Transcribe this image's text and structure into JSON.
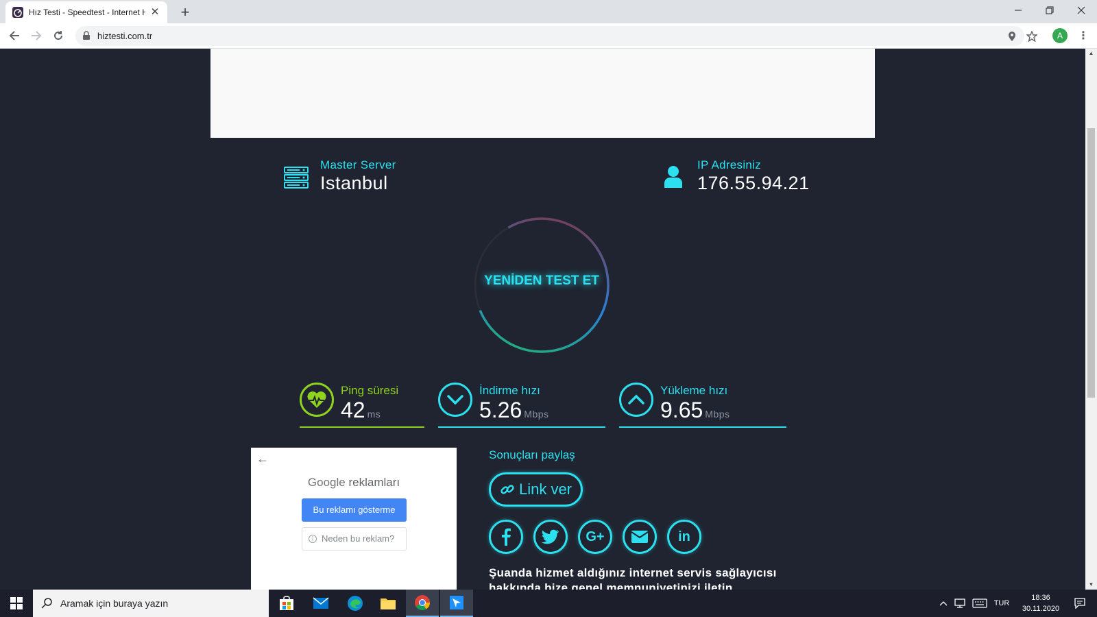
{
  "browser": {
    "tab_title": "Hız Testi - Speedtest - Internet Hız Testi",
    "url": "hiztesti.com.tr",
    "profile_initial": "A"
  },
  "server": {
    "label": "Master Server",
    "value": "Istanbul"
  },
  "ip": {
    "label": "IP Adresiniz",
    "value": "176.55.94.21"
  },
  "retest_label": "YENİDEN TEST ET",
  "metrics": {
    "ping": {
      "label": "Ping süresi",
      "value": "42",
      "unit": "ms"
    },
    "download": {
      "label": "İndirme hızı",
      "value": "5.26",
      "unit": "Mbps"
    },
    "upload": {
      "label": "Yükleme hızı",
      "value": "9.65",
      "unit": "Mbps"
    }
  },
  "ad": {
    "brand_google": "Google",
    "brand_suffix": "reklamları",
    "hide_button": "Bu reklamı gösterme",
    "why_button": "Neden bu reklam?"
  },
  "share": {
    "title": "Sonuçları paylaş",
    "link_button": "Link ver",
    "isp_text": "Şuanda hizmet aldığınız internet servis sağlayıcısı hakkında bize genel memnuniyetinizi iletin"
  },
  "taskbar": {
    "search_placeholder": "Aramak için buraya yazın",
    "language": "TUR",
    "time": "18:36",
    "date": "30.11.2020"
  },
  "colors": {
    "accent": "#2ce0f0",
    "ping": "#8fd31e",
    "background": "#1f2430"
  }
}
